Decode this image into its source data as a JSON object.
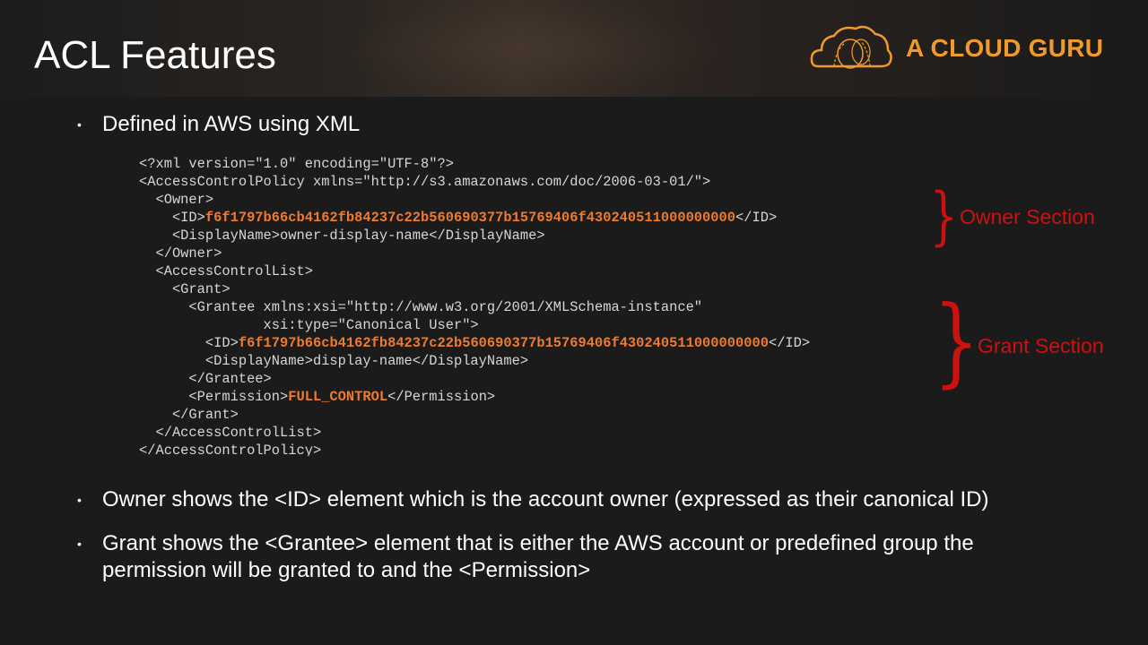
{
  "slide": {
    "title": "ACL Features"
  },
  "logo": {
    "text": "A CLOUD GURU",
    "icon": "cloud-icon",
    "color": "#f09a2c"
  },
  "bullets": [
    {
      "text": "Defined in AWS using XML"
    },
    {
      "text": "Owner shows the <ID> element which is the account owner (expressed as their canonical ID)"
    },
    {
      "text": "Grant shows the <Grantee> element that is either the AWS account or predefined group the"
    },
    {
      "text": "permission will be granted to and the <Permission>"
    }
  ],
  "code": {
    "line1": "<?xml version=\"1.0\" encoding=\"UTF-8\"?>",
    "line2": "<AccessControlPolicy xmlns=\"http://s3.amazonaws.com/doc/2006-03-01/\">",
    "line3": "  <Owner>",
    "line4_open": "    <ID>",
    "line4_value": "f6f1797b66cb4162fb84237c22b560690377b15769406f430240511000000000",
    "line4_close": "</ID>",
    "line5": "    <DisplayName>owner-display-name</DisplayName>",
    "line6": "  </Owner>",
    "line7": "  <AccessControlList>",
    "line8": "    <Grant>",
    "line9": "      <Grantee xmlns:xsi=\"http://www.w3.org/2001/XMLSchema-instance\"",
    "line10": "               xsi:type=\"Canonical User\">",
    "line11_open": "        <ID>",
    "line11_value": "f6f1797b66cb4162fb84237c22b560690377b15769406f430240511000000000",
    "line11_close": "</ID>",
    "line12": "        <DisplayName>display-name</DisplayName>",
    "line13": "      </Grantee>",
    "line14_open": "      <Permission>",
    "line14_value": "FULL_CONTROL",
    "line14_close": "</Permission>",
    "line15": "    </Grant>",
    "line16": "  </AccessControlList>",
    "line17": "</AccessControlPolicy>",
    "highlight_color": "#f07a2e"
  },
  "annotations": {
    "owner_label": "Owner Section",
    "grant_label": "Grant Section",
    "brace": "}",
    "color": "#cc1111"
  }
}
